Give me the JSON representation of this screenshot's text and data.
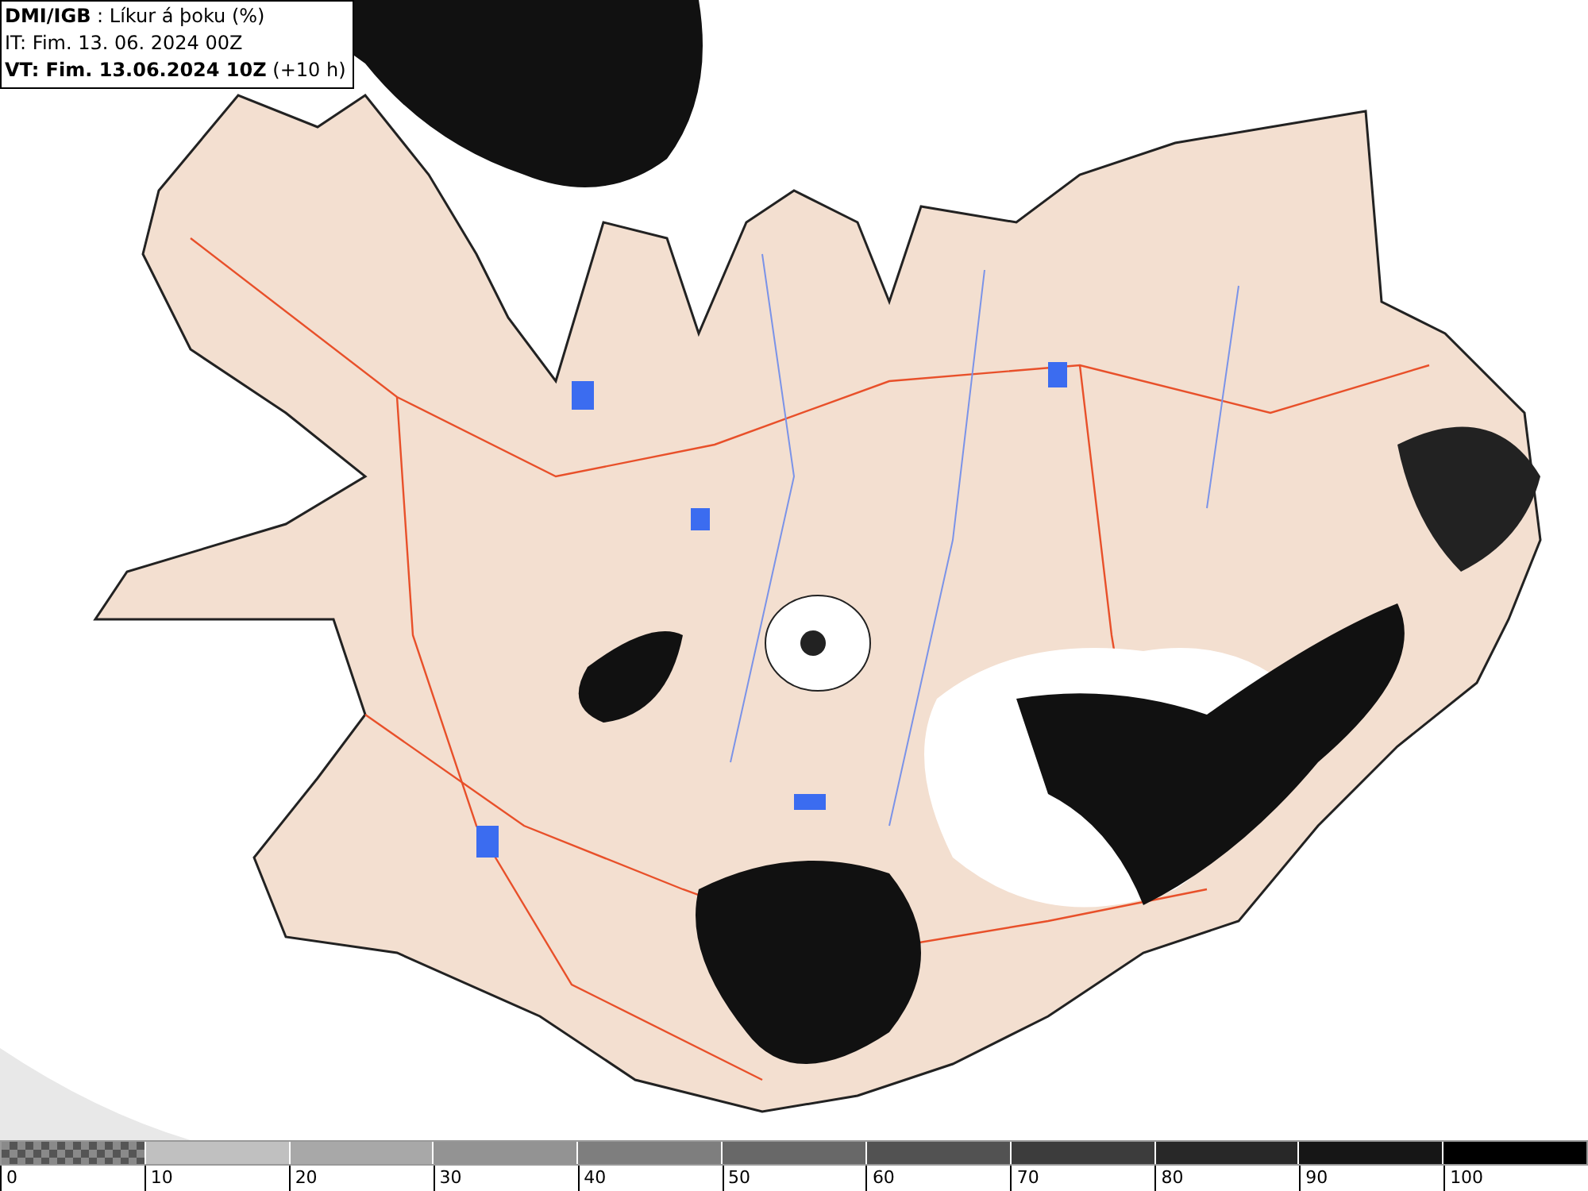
{
  "header": {
    "lines": [
      "**DMI/IGB** : Líkur á þoku (%)",
      "IT: Fim. 13. 06. 2024 00Z",
      "**VT: Fim. 13.06.2024 10Z** (+10 h)"
    ]
  },
  "legend": {
    "segments": [
      {
        "kind": "checker",
        "color": "#8a8a8a"
      },
      {
        "kind": "solid",
        "color": "#c0c0c0"
      },
      {
        "kind": "solid",
        "color": "#a8a8a8"
      },
      {
        "kind": "solid",
        "color": "#939393"
      },
      {
        "kind": "solid",
        "color": "#7e7e7e"
      },
      {
        "kind": "solid",
        "color": "#686868"
      },
      {
        "kind": "solid",
        "color": "#525252"
      },
      {
        "kind": "solid",
        "color": "#3c3c3c"
      },
      {
        "kind": "solid",
        "color": "#282828"
      },
      {
        "kind": "solid",
        "color": "#161616"
      },
      {
        "kind": "solid",
        "color": "#000000"
      }
    ],
    "labels": [
      "0",
      "10",
      "20",
      "30",
      "40",
      "50",
      "60",
      "70",
      "80",
      "90",
      "100"
    ]
  }
}
